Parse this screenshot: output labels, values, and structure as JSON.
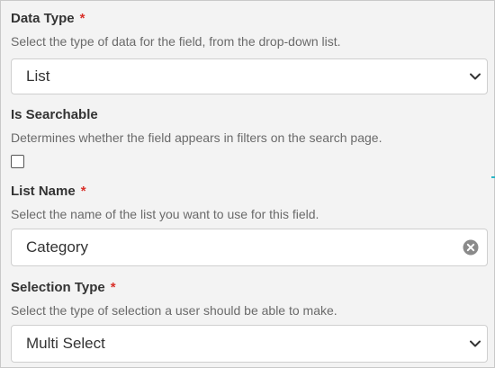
{
  "data_type": {
    "label": "Data Type",
    "required_mark": "*",
    "help": "Select the type of data for the field, from the drop-down list.",
    "value": "List"
  },
  "is_searchable": {
    "label": "Is Searchable",
    "help": "Determines whether the field appears in filters on the search page.",
    "checked": false
  },
  "list_name": {
    "label": "List Name",
    "required_mark": "*",
    "help": "Select the name of the list you want to use for this field.",
    "value": "Category"
  },
  "selection_type": {
    "label": "Selection Type",
    "required_mark": "*",
    "help": "Select the type of selection a user should be able to make.",
    "value": "Multi Select"
  },
  "colors": {
    "required": "#d9302a",
    "background": "#f3f3f3",
    "input_border": "#cfcfcf"
  },
  "icons": {
    "dropdown": "chevron-down-icon",
    "clear": "clear-icon"
  }
}
